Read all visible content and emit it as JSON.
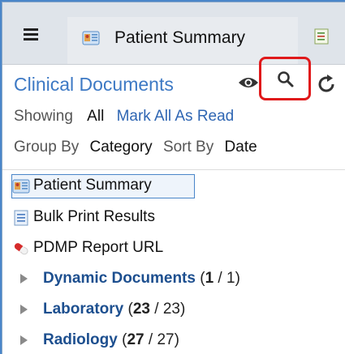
{
  "tabs": {
    "menu_icon": "hamburger-icon",
    "active": {
      "label": "Patient Summary",
      "icon": "document-summary-icon"
    },
    "next_icon": "document-list-icon"
  },
  "panel": {
    "title": "Clinical Documents",
    "icons": [
      "eye-icon",
      "search-icon",
      "refresh-icon"
    ],
    "highlight_color": "#e0191b",
    "showing_label": "Showing",
    "showing_value": "All",
    "mark_all_link": "Mark All As Read",
    "group_by_label": "Group By",
    "group_by_value": "Category",
    "sort_by_label": "Sort By",
    "sort_by_value": "Date"
  },
  "tree": {
    "documents": [
      {
        "label": "Patient Summary",
        "icon": "document-summary-icon",
        "selected": true
      },
      {
        "label": "Bulk Print Results",
        "icon": "document-list-icon",
        "selected": false
      },
      {
        "label": "PDMP Report URL",
        "icon": "pill-icon",
        "selected": false
      }
    ],
    "folders": [
      {
        "name": "Dynamic Documents",
        "unread": "1",
        "total": "1"
      },
      {
        "name": "Laboratory",
        "unread": "23",
        "total": "23"
      },
      {
        "name": "Radiology",
        "unread": "27",
        "total": "27"
      }
    ],
    "open_paren": "(",
    "separator": " / ",
    "close_paren": ")"
  }
}
